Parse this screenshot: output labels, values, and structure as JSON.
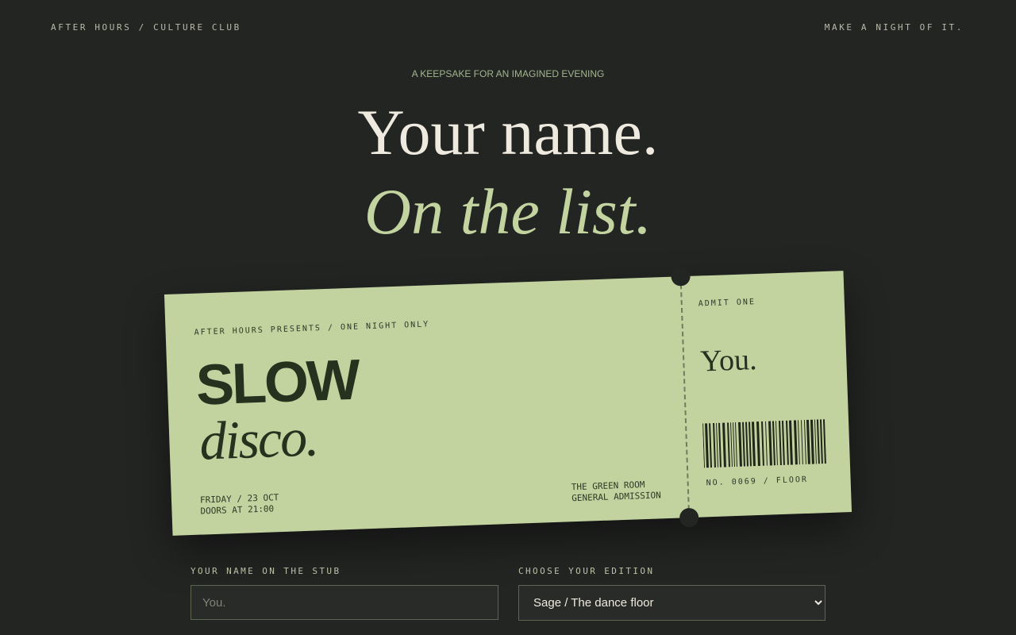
{
  "header": {
    "brand": "AFTER HOURS / CULTURE CLUB",
    "tagline": "MAKE A NIGHT OF IT."
  },
  "hero": {
    "kicker": "A KEEPSAKE FOR AN IMAGINED EVENING",
    "line1": "Your name.",
    "line2": "On the list."
  },
  "ticket": {
    "presents": "AFTER HOURS PRESENTS / ONE NIGHT ONLY",
    "title_main": "SLOW",
    "title_sub": "disco.",
    "date_line1": "FRIDAY / 23 OCT",
    "date_line2": "DOORS AT 21:00",
    "venue_line1": "THE GREEN ROOM",
    "venue_line2": "GENERAL ADMISSION",
    "admit": "ADMIT ONE",
    "holder": "You.",
    "serial": "NO. 0069 / FLOOR"
  },
  "form": {
    "name_label": "YOUR NAME ON THE STUB",
    "name_placeholder": "You.",
    "name_value": "",
    "edition_label": "CHOOSE YOUR EDITION",
    "edition_selected": "Sage / The dance floor"
  },
  "colors": {
    "background": "#232523",
    "ticket": "#c3d3a0",
    "accent": "#c3d4a0",
    "ink": "#26311e"
  }
}
